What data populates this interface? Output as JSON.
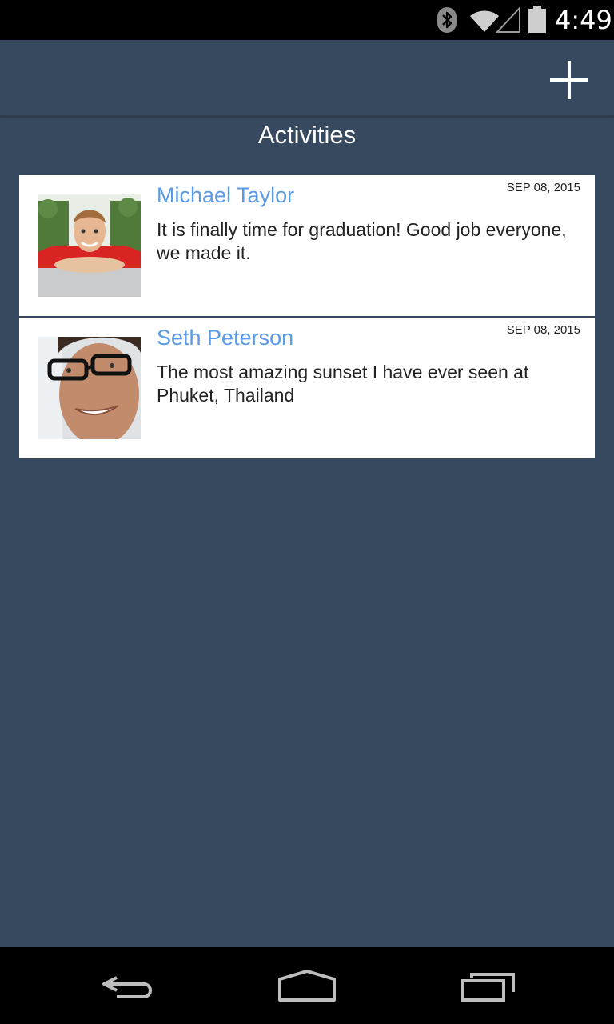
{
  "status_bar": {
    "time": "4:49"
  },
  "header": {
    "title": "Activities"
  },
  "activities": [
    {
      "name": "Michael Taylor",
      "date": "SEP 08, 2015",
      "message": "It is finally time for graduation! Good job everyone, we made it."
    },
    {
      "name": "Seth Peterson",
      "date": "SEP 08, 2015",
      "message": "The most amazing sunset I have ever seen at Phuket, Thailand"
    }
  ],
  "colors": {
    "background": "#36495e",
    "name_link": "#5b9ae6",
    "card": "#ffffff",
    "system_bar": "#000000"
  },
  "icons": {
    "status": [
      "bluetooth-icon",
      "wifi-icon",
      "cell-signal-icon",
      "battery-icon"
    ],
    "app_bar": "plus-icon",
    "nav": [
      "back-icon",
      "home-icon",
      "recent-apps-icon"
    ]
  }
}
